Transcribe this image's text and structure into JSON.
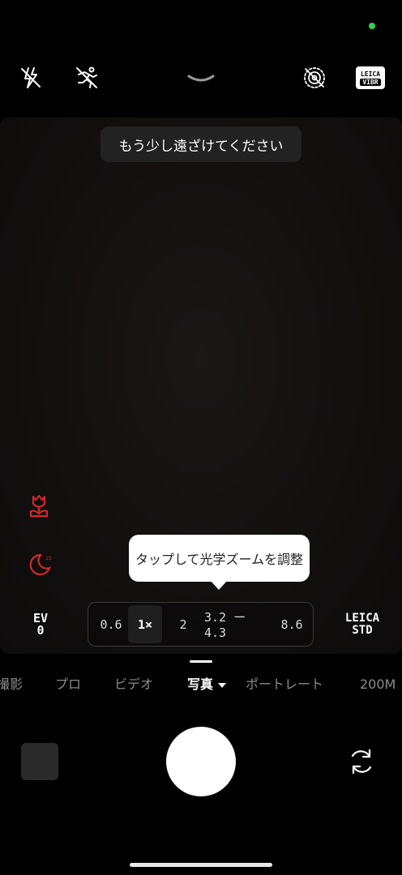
{
  "status": {
    "indicator_color": "#2fd14f"
  },
  "topbar": {
    "flash_icon": "flash-off-icon",
    "motion_icon": "motion-off-icon",
    "expand_icon": "chevron-down-icon",
    "livephoto_icon": "live-photo-off-icon",
    "leica_vibrant": {
      "line1": "LEICA",
      "line2": "VIBR"
    }
  },
  "viewfinder": {
    "hint": "もう少し遠ざけてください",
    "macro_icon": "macro-flower-icon",
    "night_icon": "night-moon-icon",
    "accent_color": "#d12a2a"
  },
  "tooltip": {
    "text": "タップして光学ズームを調整"
  },
  "controls": {
    "ev_label": "EV",
    "ev_value": "0",
    "zoom_options": [
      "0.6",
      "1×",
      "2",
      "3.2 ー 4.3",
      "8.6"
    ],
    "leica_style_line1": "LEICA",
    "leica_style_line2": "STD"
  },
  "modes": [
    "撮影",
    "プロ",
    "ビデオ",
    "写真",
    "ポートレート",
    "200M"
  ],
  "active_mode": "写真",
  "bottom": {
    "gallery_thumb": "gallery-thumbnail",
    "shutter": "shutter-button",
    "flip_icon": "switch-camera-icon"
  }
}
